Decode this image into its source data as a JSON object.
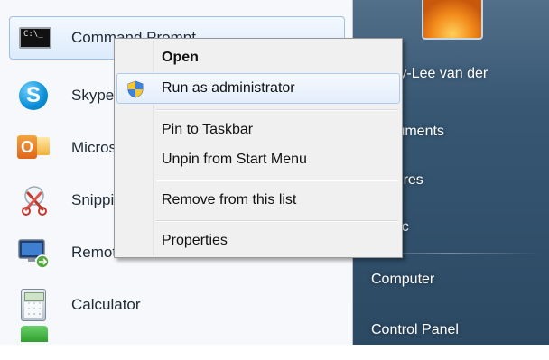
{
  "start_menu": {
    "programs": [
      {
        "label": "Command Prompt",
        "icon": "command-prompt-icon",
        "selected": true
      },
      {
        "label": "Skype",
        "icon": "skype-icon"
      },
      {
        "label": "Microsoft",
        "icon": "outlook-icon"
      },
      {
        "label": "Snipping",
        "icon": "snipping-tool-icon"
      },
      {
        "label": "Remote",
        "icon": "remote-desktop-icon"
      },
      {
        "label": "Calculator",
        "icon": "calculator-icon"
      }
    ],
    "right_pane": {
      "user_name": "Tracy-Lee van der",
      "items": [
        {
          "label": "Documents"
        },
        {
          "label": "Pictures"
        },
        {
          "label": "Music"
        },
        {
          "label": "Computer"
        },
        {
          "label": "Control Panel"
        }
      ]
    }
  },
  "context_menu": {
    "items": [
      {
        "label": "Open",
        "bold": true
      },
      {
        "label": "Run as administrator",
        "icon": "uac-shield-icon",
        "highlighted": true
      },
      {
        "label": "Pin to Taskbar"
      },
      {
        "label": "Unpin from Start Menu"
      },
      {
        "label": "Remove from this list"
      },
      {
        "label": "Properties"
      }
    ]
  },
  "colors": {
    "right_pane_bg": "#355571",
    "menu_highlight_border": "#aecbef",
    "selected_item_border": "#9dc0e8"
  }
}
